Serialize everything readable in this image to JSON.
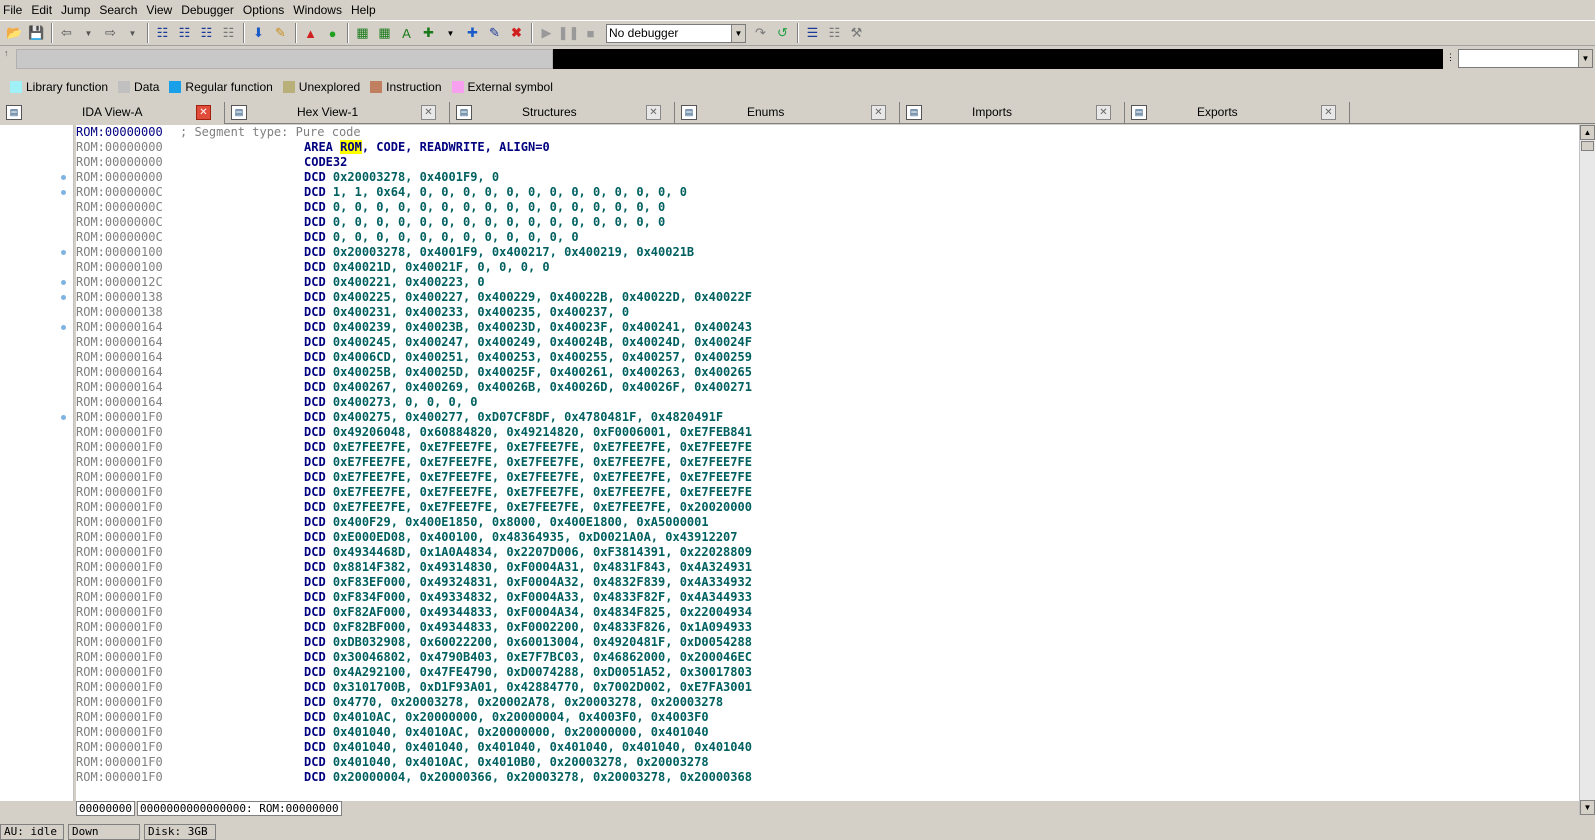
{
  "menu": [
    "File",
    "Edit",
    "Jump",
    "Search",
    "View",
    "Debugger",
    "Options",
    "Windows",
    "Help"
  ],
  "toolbar": {
    "debugger_select": "No debugger"
  },
  "legend": [
    {
      "label": "Library function",
      "color": "#a0f0f8"
    },
    {
      "label": "Data",
      "color": "#c0c0c0"
    },
    {
      "label": "Regular function",
      "color": "#1aa0e8"
    },
    {
      "label": "Unexplored",
      "color": "#b8b078"
    },
    {
      "label": "Instruction",
      "color": "#c08060"
    },
    {
      "label": "External symbol",
      "color": "#f8a0f0"
    }
  ],
  "tabs": [
    {
      "label": "IDA View-A",
      "icon": "ida-view-icon",
      "active": true
    },
    {
      "label": "Hex View-1",
      "icon": "hex-view-icon",
      "active": false
    },
    {
      "label": "Structures",
      "icon": "structures-icon",
      "active": false
    },
    {
      "label": "Enums",
      "icon": "enums-icon",
      "active": false
    },
    {
      "label": "Imports",
      "icon": "imports-icon",
      "active": false
    },
    {
      "label": "Exports",
      "icon": "exports-icon",
      "active": false
    }
  ],
  "listing": [
    {
      "addr": "ROM:00000000",
      "comment": "; Segment type: Pure code"
    },
    {
      "addr": "ROM:00000000",
      "mn": "AREA",
      "ops": "ROM, CODE, READWRITE, ALIGN=0",
      "highlight": "ROM"
    },
    {
      "addr": "ROM:00000000",
      "mn": "CODE32",
      "ops": ""
    },
    {
      "addr": "ROM:00000000",
      "mn": "DCD",
      "ops": "0x20003278, 0x4001F9, 0"
    },
    {
      "addr": "ROM:0000000C",
      "mn": "DCD",
      "ops": "1, 1, 0x64, 0, 0, 0, 0, 0, 0, 0, 0, 0, 0, 0, 0, 0"
    },
    {
      "addr": "ROM:0000000C",
      "mn": "DCD",
      "ops": "0, 0, 0, 0, 0, 0, 0, 0, 0, 0, 0, 0, 0, 0, 0, 0"
    },
    {
      "addr": "ROM:0000000C",
      "mn": "DCD",
      "ops": "0, 0, 0, 0, 0, 0, 0, 0, 0, 0, 0, 0, 0, 0, 0, 0"
    },
    {
      "addr": "ROM:0000000C",
      "mn": "DCD",
      "ops": "0, 0, 0, 0, 0, 0, 0, 0, 0, 0, 0, 0"
    },
    {
      "addr": "ROM:00000100",
      "mn": "DCD",
      "ops": "0x20003278, 0x4001F9, 0x400217, 0x400219, 0x40021B"
    },
    {
      "addr": "ROM:00000100",
      "mn": "DCD",
      "ops": "0x40021D, 0x40021F, 0, 0, 0, 0"
    },
    {
      "addr": "ROM:0000012C",
      "mn": "DCD",
      "ops": "0x400221, 0x400223, 0"
    },
    {
      "addr": "ROM:00000138",
      "mn": "DCD",
      "ops": "0x400225, 0x400227, 0x400229, 0x40022B, 0x40022D, 0x40022F"
    },
    {
      "addr": "ROM:00000138",
      "mn": "DCD",
      "ops": "0x400231, 0x400233, 0x400235, 0x400237, 0"
    },
    {
      "addr": "ROM:00000164",
      "mn": "DCD",
      "ops": "0x400239, 0x40023B, 0x40023D, 0x40023F, 0x400241, 0x400243"
    },
    {
      "addr": "ROM:00000164",
      "mn": "DCD",
      "ops": "0x400245, 0x400247, 0x400249, 0x40024B, 0x40024D, 0x40024F"
    },
    {
      "addr": "ROM:00000164",
      "mn": "DCD",
      "ops": "0x4006CD, 0x400251, 0x400253, 0x400255, 0x400257, 0x400259"
    },
    {
      "addr": "ROM:00000164",
      "mn": "DCD",
      "ops": "0x40025B, 0x40025D, 0x40025F, 0x400261, 0x400263, 0x400265"
    },
    {
      "addr": "ROM:00000164",
      "mn": "DCD",
      "ops": "0x400267, 0x400269, 0x40026B, 0x40026D, 0x40026F, 0x400271"
    },
    {
      "addr": "ROM:00000164",
      "mn": "DCD",
      "ops": "0x400273, 0, 0, 0, 0"
    },
    {
      "addr": "ROM:000001F0",
      "mn": "DCD",
      "ops": "0x400275, 0x400277, 0xD07CF8DF, 0x4780481F, 0x4820491F"
    },
    {
      "addr": "ROM:000001F0",
      "mn": "DCD",
      "ops": "0x49206048, 0x60884820, 0x49214820, 0xF0006001, 0xE7FEB841"
    },
    {
      "addr": "ROM:000001F0",
      "mn": "DCD",
      "ops": "0xE7FEE7FE, 0xE7FEE7FE, 0xE7FEE7FE, 0xE7FEE7FE, 0xE7FEE7FE"
    },
    {
      "addr": "ROM:000001F0",
      "mn": "DCD",
      "ops": "0xE7FEE7FE, 0xE7FEE7FE, 0xE7FEE7FE, 0xE7FEE7FE, 0xE7FEE7FE"
    },
    {
      "addr": "ROM:000001F0",
      "mn": "DCD",
      "ops": "0xE7FEE7FE, 0xE7FEE7FE, 0xE7FEE7FE, 0xE7FEE7FE, 0xE7FEE7FE"
    },
    {
      "addr": "ROM:000001F0",
      "mn": "DCD",
      "ops": "0xE7FEE7FE, 0xE7FEE7FE, 0xE7FEE7FE, 0xE7FEE7FE, 0xE7FEE7FE"
    },
    {
      "addr": "ROM:000001F0",
      "mn": "DCD",
      "ops": "0xE7FEE7FE, 0xE7FEE7FE, 0xE7FEE7FE, 0xE7FEE7FE, 0x20020000"
    },
    {
      "addr": "ROM:000001F0",
      "mn": "DCD",
      "ops": "0x400F29, 0x400E1850, 0x8000, 0x400E1800, 0xA5000001"
    },
    {
      "addr": "ROM:000001F0",
      "mn": "DCD",
      "ops": "0xE000ED08, 0x400100, 0x48364935, 0xD0021A0A, 0x43912207"
    },
    {
      "addr": "ROM:000001F0",
      "mn": "DCD",
      "ops": "0x4934468D, 0x1A0A4834, 0x2207D006, 0xF3814391, 0x22028809"
    },
    {
      "addr": "ROM:000001F0",
      "mn": "DCD",
      "ops": "0x8814F382, 0x49314830, 0xF0004A31, 0x4831F843, 0x4A324931"
    },
    {
      "addr": "ROM:000001F0",
      "mn": "DCD",
      "ops": "0xF83EF000, 0x49324831, 0xF0004A32, 0x4832F839, 0x4A334932"
    },
    {
      "addr": "ROM:000001F0",
      "mn": "DCD",
      "ops": "0xF834F000, 0x49334832, 0xF0004A33, 0x4833F82F, 0x4A344933"
    },
    {
      "addr": "ROM:000001F0",
      "mn": "DCD",
      "ops": "0xF82AF000, 0x49344833, 0xF0004A34, 0x4834F825, 0x22004934"
    },
    {
      "addr": "ROM:000001F0",
      "mn": "DCD",
      "ops": "0xF82BF000, 0x49344833, 0xF0002200, 0x4833F826, 0x1A094933"
    },
    {
      "addr": "ROM:000001F0",
      "mn": "DCD",
      "ops": "0xDB032908, 0x60022200, 0x60013004, 0x4920481F, 0xD0054288"
    },
    {
      "addr": "ROM:000001F0",
      "mn": "DCD",
      "ops": "0x30046802, 0x4790B403, 0xE7F7BC03, 0x46862000, 0x200046EC"
    },
    {
      "addr": "ROM:000001F0",
      "mn": "DCD",
      "ops": "0x4A292100, 0x47FE4790, 0xD0074288, 0xD0051A52, 0x30017803"
    },
    {
      "addr": "ROM:000001F0",
      "mn": "DCD",
      "ops": "0x3101700B, 0xD1F93A01, 0x42884770, 0x7002D002, 0xE7FA3001"
    },
    {
      "addr": "ROM:000001F0",
      "mn": "DCD",
      "ops": "0x4770, 0x20003278, 0x20002A78, 0x20003278, 0x20003278"
    },
    {
      "addr": "ROM:000001F0",
      "mn": "DCD",
      "ops": "0x4010AC, 0x20000000, 0x20000004, 0x4003F0, 0x4003F0"
    },
    {
      "addr": "ROM:000001F0",
      "mn": "DCD",
      "ops": "0x401040, 0x4010AC, 0x20000000, 0x20000000, 0x401040"
    },
    {
      "addr": "ROM:000001F0",
      "mn": "DCD",
      "ops": "0x401040, 0x401040, 0x401040, 0x401040, 0x401040, 0x401040"
    },
    {
      "addr": "ROM:000001F0",
      "mn": "DCD",
      "ops": "0x401040, 0x4010AC, 0x4010B0, 0x20003278, 0x20003278"
    },
    {
      "addr": "ROM:000001F0",
      "mn": "DCD",
      "ops": "0x20000004, 0x20000366, 0x20003278, 0x20003278, 0x20000368"
    }
  ],
  "gutter_dots": [
    3,
    4,
    8,
    10,
    11,
    13,
    19
  ],
  "position_bar": {
    "offset": "00000000",
    "location": "0000000000000000: ROM:00000000"
  },
  "status": {
    "au": "AU:  idle",
    "direction": "Down",
    "disk": "Disk: 3GB"
  }
}
